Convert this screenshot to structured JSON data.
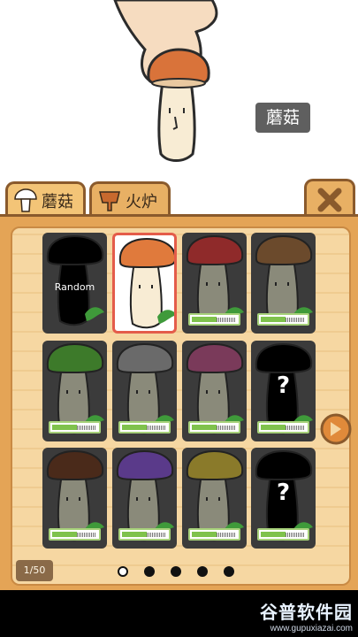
{
  "scene": {
    "name_tag": "蘑菇"
  },
  "tabs": [
    {
      "label": "蘑菇",
      "icon": "mushroom-icon",
      "active": true
    },
    {
      "label": "火炉",
      "icon": "stove-icon",
      "active": false
    }
  ],
  "colors": {
    "panel": "#e4a456",
    "panel_inner": "#f6d7a2",
    "slot_dark": "#3b3b3b",
    "progress_green": "#7fc24c",
    "selected_border": "#e45c4a"
  },
  "slots": [
    {
      "label": "Random",
      "kind": "random",
      "cap": "#000000",
      "progress": 0
    },
    {
      "label": "",
      "kind": "selected",
      "cap": "#e07a3c",
      "progress": 0
    },
    {
      "label": "",
      "kind": "unlocked",
      "cap": "#8f2a2a",
      "progress": 0.55
    },
    {
      "label": "",
      "kind": "unlocked",
      "cap": "#6b4a2c",
      "progress": 0.55
    },
    {
      "label": "",
      "kind": "unlocked",
      "cap": "#3d7a2a",
      "progress": 0.55
    },
    {
      "label": "",
      "kind": "unlocked",
      "cap": "#6a6a6a",
      "progress": 0.55
    },
    {
      "label": "",
      "kind": "unlocked",
      "cap": "#7a3a5a",
      "progress": 0.55
    },
    {
      "label": "?",
      "kind": "unknown",
      "cap": "#000000",
      "progress": 0.55
    },
    {
      "label": "",
      "kind": "unlocked",
      "cap": "#4a2a1a",
      "progress": 0.55
    },
    {
      "label": "",
      "kind": "unlocked",
      "cap": "#5a3a8a",
      "progress": 0.55
    },
    {
      "label": "",
      "kind": "unlocked",
      "cap": "#8a7a2a",
      "progress": 0.55
    },
    {
      "label": "?",
      "kind": "unknown",
      "cap": "#000000",
      "progress": 0.55
    }
  ],
  "page_counter": "1/50",
  "pager": {
    "count": 5,
    "active_index": 0
  },
  "watermark": {
    "title": "谷普软件园",
    "url": "www.gupuxiazai.com"
  }
}
